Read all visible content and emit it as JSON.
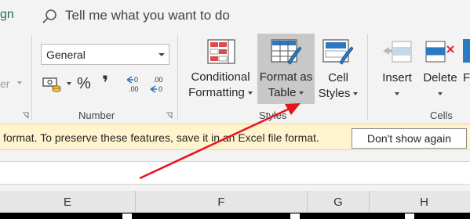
{
  "tellbar": {
    "tab_fragment": "gn",
    "search_placeholder": "Tell me what you want to do"
  },
  "ribbon": {
    "left_fragment": "er",
    "number_group": {
      "format_value": "General",
      "percent_symbol": "%",
      "comma_symbol": "❜",
      "increase_decimal": "←0 .00",
      "decrease_decimal": ".00 →0",
      "label": "Number"
    },
    "styles_group": {
      "conditional_formatting": [
        "Conditional",
        "Formatting"
      ],
      "format_as_table": [
        "Format as",
        "Table"
      ],
      "cell_styles": [
        "Cell",
        "Styles"
      ],
      "label": "Styles"
    },
    "cells_group": {
      "insert": "Insert",
      "delete": "Delete",
      "format_fragment": "F",
      "label": "Cells"
    }
  },
  "message_bar": {
    "text": "format. To preserve these features, save it in an Excel file format.",
    "dismiss_label": "Don't show again"
  },
  "columns": [
    "E",
    "F",
    "G",
    "H"
  ],
  "colors": {
    "accent_green": "#217346",
    "arrow_red": "#e8141b",
    "message_bg": "#fff4ce"
  }
}
